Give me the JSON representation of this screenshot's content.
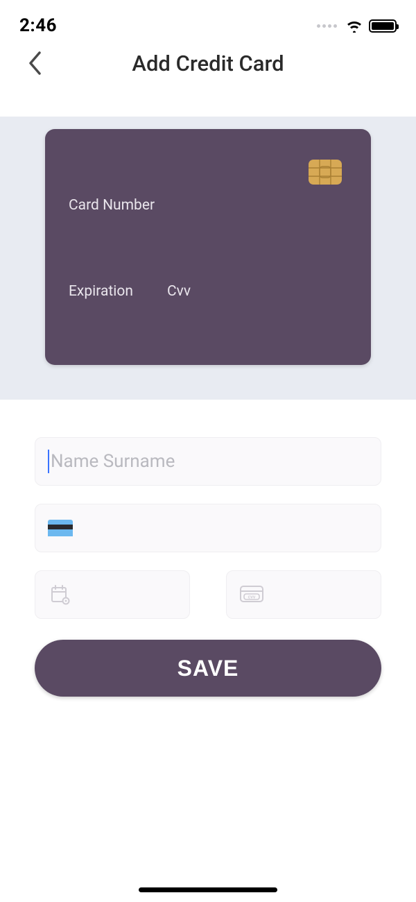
{
  "status": {
    "time": "2:46"
  },
  "header": {
    "title": "Add Credit Card"
  },
  "card": {
    "card_number_label": "Card Number",
    "expiration_label": "Expiration",
    "cvv_label": "Cvv"
  },
  "form": {
    "name_placeholder": "Name Surname",
    "card_number_placeholder": "",
    "expiry_placeholder": "",
    "cvv_placeholder": ""
  },
  "actions": {
    "save_label": "SAVE"
  },
  "colors": {
    "card_bg": "#5a4a63",
    "panel_bg": "#e8ebf2",
    "field_bg": "#faf9fb"
  }
}
